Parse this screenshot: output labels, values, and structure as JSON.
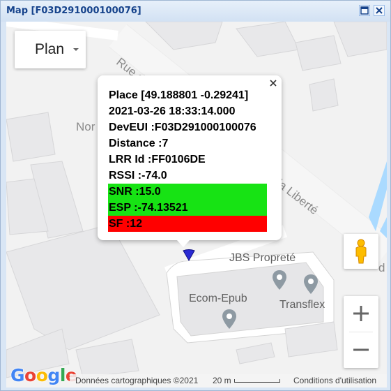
{
  "window": {
    "title": "Map [F03D291000100076]",
    "maximize_icon": "maximize-icon",
    "close_icon": "close-icon"
  },
  "map": {
    "type_selector": {
      "label": "Plan",
      "icon": "chevron-down-icon"
    },
    "street_labels": [
      "Rue d",
      "Nor",
      "la Liberté",
      "d"
    ],
    "popup": {
      "close_icon": "close-icon",
      "lines": [
        {
          "text": "Place [49.188801 -0.29241]",
          "bg": ""
        },
        {
          "text": "2021-03-26 18:33:14.000",
          "bg": ""
        },
        {
          "text": "DevEUI :F03D291000100076",
          "bg": ""
        },
        {
          "text": "Distance :7",
          "bg": ""
        },
        {
          "text": "LRR Id :FF0106DE",
          "bg": ""
        },
        {
          "text": "RSSI :-74.0",
          "bg": ""
        },
        {
          "text": "SNR :15.0",
          "bg": "#17e314"
        },
        {
          "text": "ESP :-74.13521",
          "bg": "#17e314"
        },
        {
          "text": "SF :12",
          "bg": "#ff0000"
        }
      ]
    },
    "marker_icon": "map-marker-icon",
    "pois": [
      {
        "label": "JBS Propreté",
        "icon": "place-pin-icon"
      },
      {
        "label": "Ecom-Epub",
        "icon": "place-pin-icon"
      },
      {
        "label": "Transflex",
        "icon": "place-pin-icon"
      }
    ],
    "controls": {
      "pegman_icon": "street-view-pegman-icon",
      "zoom_in": "+",
      "zoom_out": "−"
    },
    "footer": {
      "logo": "Google",
      "copyright": "Données cartographiques ©2021",
      "scale": "20 m",
      "terms": "Conditions d'utilisation"
    }
  },
  "colors": {
    "title_text": "#15428b",
    "snr_ok": "#17e314",
    "sf_bad": "#ff0000",
    "marker": "#2a2ad4"
  }
}
